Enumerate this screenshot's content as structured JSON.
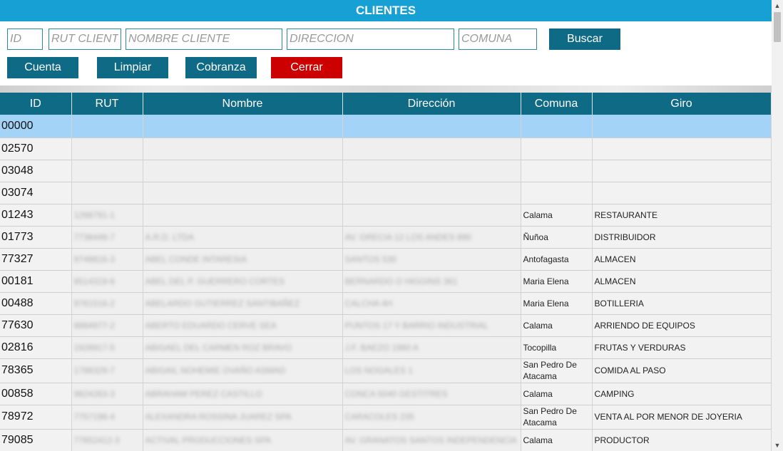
{
  "window": {
    "title": "CLIENTES"
  },
  "search": {
    "id_placeholder": "ID",
    "rut_placeholder": "RUT CLIENTE",
    "name_placeholder": "NOMBRE CLIENTE",
    "address_placeholder": "DIRECCION",
    "commune_placeholder": "COMUNA",
    "search_label": "Buscar"
  },
  "actions": {
    "account": "Cuenta",
    "clear": "Limpiar",
    "collection": "Cobranza",
    "close": "Cerrar"
  },
  "colors": {
    "title_bar": "#17a0d4",
    "header": "#0f6a86",
    "close_button": "#cc0000",
    "selected_row": "#a3d3f7"
  },
  "table": {
    "headers": [
      "ID",
      "RUT",
      "Nombre",
      "Dirección",
      "Comuna",
      "Giro"
    ],
    "rows": [
      {
        "id": "00000",
        "rut": "",
        "name": "",
        "address": "",
        "commune": "",
        "business": ""
      },
      {
        "id": "02570",
        "rut": "",
        "name": "",
        "address": "",
        "commune": "",
        "business": ""
      },
      {
        "id": "03048",
        "rut": "",
        "name": "",
        "address": "",
        "commune": "",
        "business": ""
      },
      {
        "id": "03074",
        "rut": "",
        "name": "",
        "address": "",
        "commune": "",
        "business": ""
      },
      {
        "id": "01243",
        "rut": "1268791-1",
        "name": "",
        "address": "",
        "commune": "Calama",
        "business": "RESTAURANTE"
      },
      {
        "id": "01773",
        "rut": "7738449-7",
        "name": "A.R.D. LTDA",
        "address": "AV. GRECIA 12 LOS ANDES 890",
        "commune": "Ñuñoa",
        "business": "DISTRIBUIDOR"
      },
      {
        "id": "77327",
        "rut": "9748816-3",
        "name": "ABEL CONDE INTARESIA",
        "address": "SANTOS 530",
        "commune": "Antofagasta",
        "business": "ALMACEN"
      },
      {
        "id": "00181",
        "rut": "8514319-6",
        "name": "ABEL DEL P. GUERRERO CORTES",
        "address": "BERNARDO O HIGGINS 361",
        "commune": "Maria Elena",
        "business": "ALMACEN"
      },
      {
        "id": "00488",
        "rut": "9761516-2",
        "name": "ABELARDO GUTIERREZ SANTIBAÑEZ",
        "address": "CALCHA 4H",
        "commune": "Maria Elena",
        "business": "BOTILLERIA"
      },
      {
        "id": "77630",
        "rut": "8884977-2",
        "name": "ABERTO EDUARDO CERVE SEA",
        "address": "PUNTOS 17 Y BARRIO INDUSTRIAL",
        "commune": "Calama",
        "business": "ARRIENDO DE EQUIPOS"
      },
      {
        "id": "02816",
        "rut": "1928917-5",
        "name": "ABIGAEL DEL CARMEN ROZ BRAVO",
        "address": "J.F. BAEZO 1960 A",
        "commune": "Tocopilla",
        "business": "FRUTAS Y VERDURAS"
      },
      {
        "id": "78365",
        "rut": "1799329-7",
        "name": "ABIGAIL NOHEMIE OVAÑO ASMAD",
        "address": "LOS NOGALES 1",
        "commune": "San Pedro De Atacama",
        "business": "COMIDA AL PASO"
      },
      {
        "id": "00858",
        "rut": "9824263-3",
        "name": "ABRAHAM PEREZ CASTILLO",
        "address": "CONCA 5040 GESTITRES",
        "commune": "Calama",
        "business": "CAMPING"
      },
      {
        "id": "78972",
        "rut": "7757198-4",
        "name": "ALEXANDRA ROSSINA JUAREZ SPA",
        "address": "CARACOLES 235",
        "commune": "San Pedro De Atacama",
        "business": "VENTA AL POR MENOR DE JOYERIA"
      },
      {
        "id": "79085",
        "rut": "77652412-3",
        "name": "ACTIVAL PRODUCCIONES SPA",
        "address": "AV. GRANATOS SANTOS INDEPENDENCIA",
        "commune": "Calama",
        "business": "PRODUCTOR"
      }
    ]
  }
}
